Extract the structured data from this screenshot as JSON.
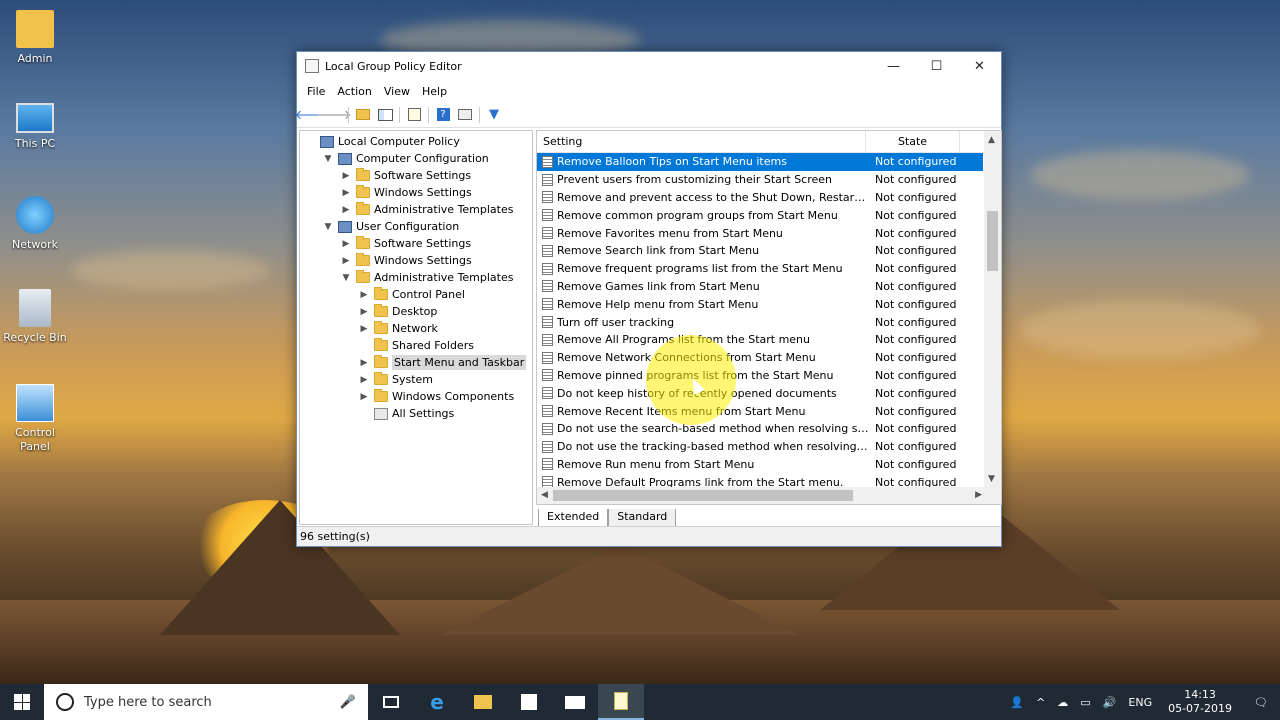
{
  "desktop": {
    "icons": [
      {
        "label": "Admin",
        "icon": "user-folder-icon"
      },
      {
        "label": "This PC",
        "icon": "computer-icon"
      },
      {
        "label": "Network",
        "icon": "network-icon"
      },
      {
        "label": "Recycle Bin",
        "icon": "recycle-bin-icon"
      },
      {
        "label": "Control Panel",
        "icon": "control-panel-icon"
      }
    ]
  },
  "window": {
    "title": "Local Group Policy Editor",
    "controls": {
      "minimize": "—",
      "maximize": "☐",
      "close": "✕"
    },
    "menu": [
      "File",
      "Action",
      "View",
      "Help"
    ],
    "toolbar": {
      "back": "🡐",
      "forward": "🡒"
    }
  },
  "tree": [
    {
      "label": "Local Computer Policy",
      "expander": "",
      "kind": "pc"
    },
    {
      "label": "Computer Configuration",
      "expander": "▼",
      "kind": "pc"
    },
    {
      "label": "Software Settings",
      "expander": "▶",
      "kind": "folder"
    },
    {
      "label": "Windows Settings",
      "expander": "▶",
      "kind": "folder"
    },
    {
      "label": "Administrative Templates",
      "expander": "▶",
      "kind": "folder"
    },
    {
      "label": "User Configuration",
      "expander": "▼",
      "kind": "pc"
    },
    {
      "label": "Software Settings",
      "expander": "▶",
      "kind": "folder"
    },
    {
      "label": "Windows Settings",
      "expander": "▶",
      "kind": "folder"
    },
    {
      "label": "Administrative Templates",
      "expander": "▼",
      "kind": "folder"
    },
    {
      "label": "Control Panel",
      "expander": "▶",
      "kind": "folder"
    },
    {
      "label": "Desktop",
      "expander": "▶",
      "kind": "folder"
    },
    {
      "label": "Network",
      "expander": "▶",
      "kind": "folder"
    },
    {
      "label": "Shared Folders",
      "expander": "",
      "kind": "folder"
    },
    {
      "label": "Start Menu and Taskbar",
      "expander": "▶",
      "kind": "folder",
      "selected": true
    },
    {
      "label": "System",
      "expander": "▶",
      "kind": "folder"
    },
    {
      "label": "Windows Components",
      "expander": "▶",
      "kind": "folder"
    },
    {
      "label": "All Settings",
      "expander": "",
      "kind": "settings"
    }
  ],
  "list": {
    "headers": {
      "setting": "Setting",
      "state": "State"
    },
    "rows": [
      {
        "name": "Remove Balloon Tips on Start Menu items",
        "state": "Not configured",
        "selected": true
      },
      {
        "name": "Prevent users from customizing their Start Screen",
        "state": "Not configured"
      },
      {
        "name": "Remove and prevent access to the Shut Down, Restart, Sleep...",
        "state": "Not configured"
      },
      {
        "name": "Remove common program groups from Start Menu",
        "state": "Not configured"
      },
      {
        "name": "Remove Favorites menu from Start Menu",
        "state": "Not configured"
      },
      {
        "name": "Remove Search link from Start Menu",
        "state": "Not configured"
      },
      {
        "name": "Remove frequent programs list from the Start Menu",
        "state": "Not configured"
      },
      {
        "name": "Remove Games link from Start Menu",
        "state": "Not configured"
      },
      {
        "name": "Remove Help menu from Start Menu",
        "state": "Not configured"
      },
      {
        "name": "Turn off user tracking",
        "state": "Not configured"
      },
      {
        "name": "Remove All Programs list from the Start menu",
        "state": "Not configured"
      },
      {
        "name": "Remove Network Connections from Start Menu",
        "state": "Not configured"
      },
      {
        "name": "Remove pinned programs list from the Start Menu",
        "state": "Not configured"
      },
      {
        "name": "Do not keep history of recently opened documents",
        "state": "Not configured"
      },
      {
        "name": "Remove Recent Items menu from Start Menu",
        "state": "Not configured"
      },
      {
        "name": "Do not use the search-based method when resolving shell s...",
        "state": "Not configured"
      },
      {
        "name": "Do not use the tracking-based method when resolving shell ...",
        "state": "Not configured"
      },
      {
        "name": "Remove Run menu from Start Menu",
        "state": "Not configured"
      },
      {
        "name": "Remove Default Programs link from the Start menu.",
        "state": "Not configured"
      }
    ]
  },
  "tabs": [
    "Extended",
    "Standard"
  ],
  "status": "96 setting(s)",
  "taskbar": {
    "search_placeholder": "Type here to search",
    "lang": "ENG",
    "time": "14:13",
    "date": "05-07-2019"
  },
  "colors": {
    "selection": "#0078d7",
    "taskbar": "#1f2a34"
  }
}
